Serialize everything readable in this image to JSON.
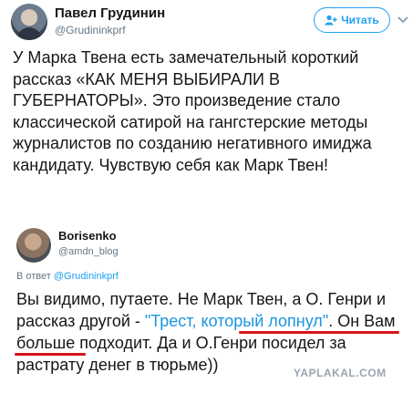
{
  "tweet": {
    "author_name": "Павел Грудинин",
    "author_handle": "@Grudininkprf",
    "follow_label": "Читать",
    "text": "У Марка Твена есть замечательный короткий рассказ «КАК МЕНЯ ВЫБИРАЛИ В ГУБЕРНАТОРЫ». Это произведение  стало классической сатирой на гангстерские методы журналистов по созданию негативного имиджа кандидату. Чувствую себя как Марк Твен!"
  },
  "reply": {
    "author_name": "Borisenko",
    "author_handle": "@amdn_blog",
    "context_prefix": "В ответ ",
    "context_mention": "@Grudininkprf",
    "text_before": "Вы видимо, путаете. Не Марк Твен, а О. Генри и рассказ другой - ",
    "link_text": "\"Трест, который лопнул\"",
    "text_after": ". Он Вам больше подходит. Да и О.Генри посидел за растрату денег в тюрьме))"
  },
  "watermark": "YAPLAKAL.COM",
  "colors": {
    "accent": "#1da1f2",
    "link": "#1b95e0",
    "highlight_underline": "#d6131b",
    "secondary_text": "#657786"
  },
  "icons": {
    "follow": "add-user-icon",
    "menu": "chevron-down-icon"
  }
}
